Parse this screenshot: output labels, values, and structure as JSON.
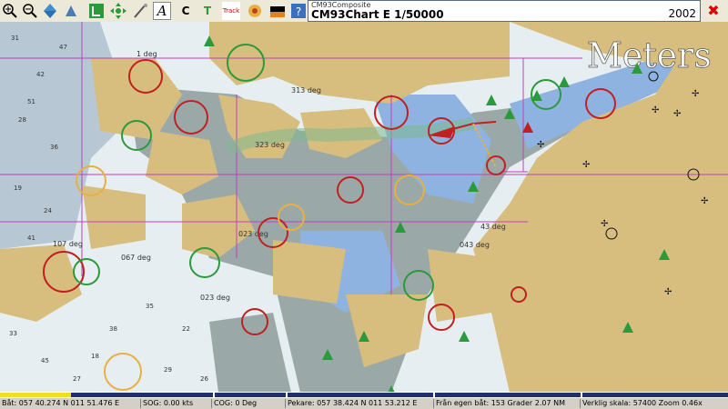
{
  "chart_info": {
    "subtitle": "CM93Composite",
    "title": "CM93Chart E  1/50000",
    "year": "2002"
  },
  "map": {
    "watermark": "Meters",
    "depth_labels": [
      "313 deg",
      "323 deg",
      "43 deg",
      "043 deg",
      "107 deg",
      "067 deg",
      "023 deg",
      "023 deg",
      "1 deg"
    ],
    "soundings": [
      "31",
      "42",
      "28",
      "36",
      "19",
      "24",
      "33",
      "45",
      "27",
      "38",
      "22",
      "29",
      "51",
      "47",
      "35",
      "26",
      "18",
      "41"
    ]
  },
  "statusbar": {
    "position": "Båt: 057 40.274 N   011 51.476 E",
    "speed": "SOG:   0.00 kts",
    "course": "COG:      0 Deg",
    "cursor": "Pekare: 057 38.424 N   011 53.212 E",
    "bearing": "Från egen båt: 153 Grader     2.07 NM",
    "scale": "Verklig skala:     57400   Zoom 0.46x"
  },
  "colors": {
    "land": "#d8be7e",
    "shallow_water": "#8fb3e0",
    "mid_water": "#b7c7d4",
    "deep_water": "#e6eef2",
    "channel": "#9aa9a8",
    "magenta": "#c040c0"
  },
  "icons": [
    "zoom-in-icon",
    "zoom-out-icon",
    "north-up-icon",
    "track-icon",
    "pan-icon",
    "measure-icon",
    "text-icon",
    "copy-icon",
    "tide-icon",
    "track-button-icon",
    "chart-icon",
    "color-icon",
    "help-icon",
    "close-icon"
  ]
}
